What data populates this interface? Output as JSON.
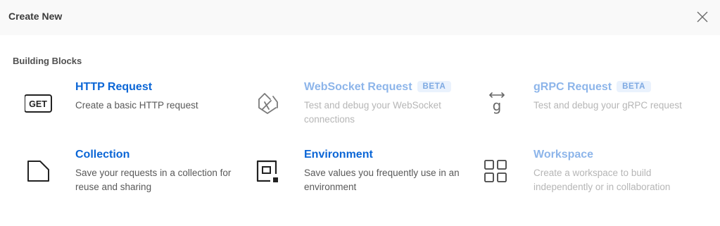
{
  "header": {
    "title": "Create New"
  },
  "section": {
    "title": "Building Blocks"
  },
  "blocks": [
    {
      "title": "HTTP Request",
      "icon_text": "GET",
      "description": "Create a basic HTTP request",
      "badge": "",
      "enabled": true,
      "icon": "get-request-icon"
    },
    {
      "title": "WebSocket Request",
      "description": "Test and debug your WebSocket connections",
      "badge": "BETA",
      "enabled": false,
      "icon": "websocket-icon"
    },
    {
      "title": "gRPC Request",
      "icon_text": "g",
      "description": "Test and debug your gRPC request",
      "badge": "BETA",
      "enabled": false,
      "icon": "grpc-icon"
    },
    {
      "title": "Collection",
      "description": "Save your requests in a collection for reuse and sharing",
      "badge": "",
      "enabled": true,
      "icon": "collection-icon"
    },
    {
      "title": "Environment",
      "description": "Save values you frequently use in an environment",
      "badge": "",
      "enabled": true,
      "icon": "environment-icon"
    },
    {
      "title": "Workspace",
      "description": "Create a workspace to build independently or in collaboration",
      "badge": "",
      "enabled": false,
      "icon": "workspace-icon"
    }
  ],
  "colors": {
    "accent": "#0b66d6",
    "accent_disabled": "#8db5ea",
    "badge_bg": "#eaf2fd",
    "header_bg": "#f9f9f9"
  }
}
